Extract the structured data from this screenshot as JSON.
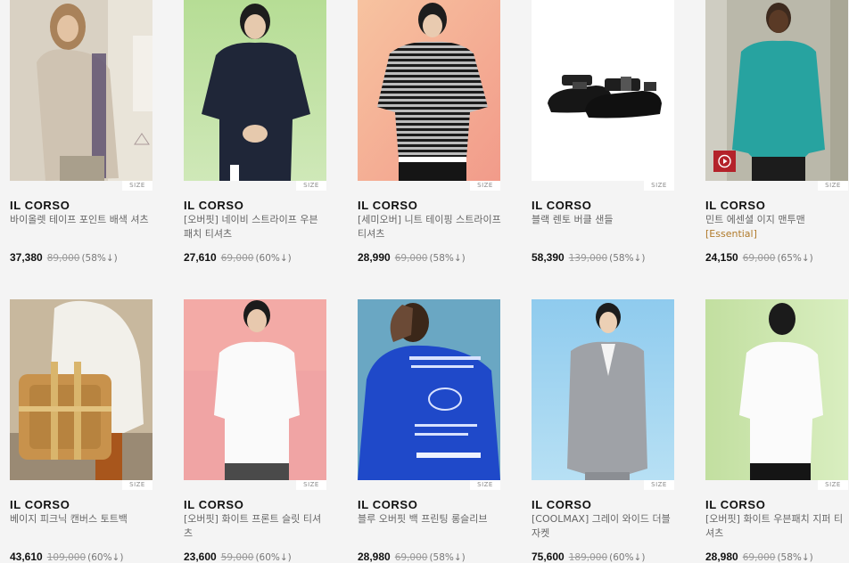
{
  "products": [
    {
      "brand": "IL CORSO",
      "name": "바이올렛 테이프 포인트 배색 셔츠",
      "tag": "",
      "price": "37,380",
      "original_price": "89,000",
      "discount": "(58%↓)",
      "size_label": "SIZE",
      "image_icon": "model-wearing-shirt-photo",
      "bg_color": "#d8cfc0"
    },
    {
      "brand": "IL CORSO",
      "name": "[오버핏] 네이비 스트라이프 우븐 패치 티셔츠",
      "tag": "",
      "price": "27,610",
      "original_price": "69,000",
      "discount": "(60%↓)",
      "size_label": "SIZE",
      "image_icon": "model-wearing-tshirt-photo",
      "bg_color": "#a7d489"
    },
    {
      "brand": "IL CORSO",
      "name": "[세미오버] 니트 테이핑 스트라이프 티셔츠",
      "tag": "",
      "price": "28,990",
      "original_price": "69,000",
      "discount": "(58%↓)",
      "size_label": "SIZE",
      "image_icon": "model-wearing-striped-tshirt-photo",
      "bg_color": "#f2b193"
    },
    {
      "brand": "IL CORSO",
      "name": "블랙 렌토 버클 샌들",
      "tag": "",
      "price": "58,390",
      "original_price": "139,000",
      "discount": "(58%↓)",
      "size_label": "SIZE",
      "image_icon": "sandals-photo",
      "bg_color": "#ffffff"
    },
    {
      "brand": "IL CORSO",
      "name": "민트 에센셜 이지 맨투맨",
      "tag": "[Essential]",
      "price": "24,150",
      "original_price": "69,000",
      "discount": "(65%↓)",
      "size_label": "SIZE",
      "image_icon": "model-wearing-sweatshirt-photo",
      "bg_color": "#b9b7a8",
      "has_video": true,
      "video_icon": "play-icon"
    },
    {
      "brand": "IL CORSO",
      "name": "베이지 피크닉 캔버스 토트백",
      "tag": "",
      "price": "43,610",
      "original_price": "109,000",
      "discount": "(60%↓)",
      "size_label": "SIZE",
      "image_icon": "model-carrying-tote-bag-photo",
      "bg_color": "#c7b79d"
    },
    {
      "brand": "IL CORSO",
      "name": "[오버핏] 화이트 프론트 슬릿 티셔츠",
      "tag": "",
      "price": "23,600",
      "original_price": "59,000",
      "discount": "(60%↓)",
      "size_label": "SIZE",
      "image_icon": "model-wearing-white-tshirt-photo",
      "bg_color": "#f2a3a3"
    },
    {
      "brand": "IL CORSO",
      "name": "블루 오버핏 백 프린팅 롱슬리브",
      "tag": "",
      "price": "28,980",
      "original_price": "69,000",
      "discount": "(58%↓)",
      "size_label": "SIZE",
      "image_icon": "model-wearing-blue-longsleeve-photo",
      "bg_color": "#6aa8c4"
    },
    {
      "brand": "IL CORSO",
      "name": "[COOLMAX] 그레이 와이드 더블 자켓",
      "tag": "",
      "price": "75,600",
      "original_price": "189,000",
      "discount": "(60%↓)",
      "size_label": "SIZE",
      "image_icon": "model-wearing-gray-jacket-photo",
      "bg_color": "#9fd3ef"
    },
    {
      "brand": "IL CORSO",
      "name": "[오버핏] 화이트 우븐패치 지퍼 티셔츠",
      "tag": "",
      "price": "28,980",
      "original_price": "69,000",
      "discount": "(58%↓)",
      "size_label": "SIZE",
      "image_icon": "model-wearing-white-tshirt-back-photo",
      "bg_color": "#c9e4a0"
    }
  ]
}
